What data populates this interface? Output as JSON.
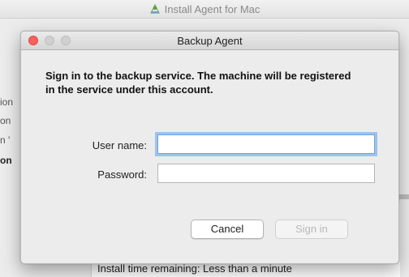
{
  "background_window": {
    "title": "Install Agent for Mac",
    "sidebar_fragments": [
      "ion",
      "on",
      "n '",
      "on"
    ],
    "status_text": "Install time remaining: Less than a minute"
  },
  "modal": {
    "title": "Backup Agent",
    "instructions": "Sign in to the backup service. The machine will be registered in the service under this account.",
    "username_label": "User name:",
    "username_value": "",
    "password_label": "Password:",
    "password_value": "",
    "cancel_label": "Cancel",
    "signin_label": "Sign in"
  },
  "colors": {
    "close_button": "#fc605c",
    "focus_ring": "#9ec3ec",
    "window_bg": "#ececec"
  }
}
